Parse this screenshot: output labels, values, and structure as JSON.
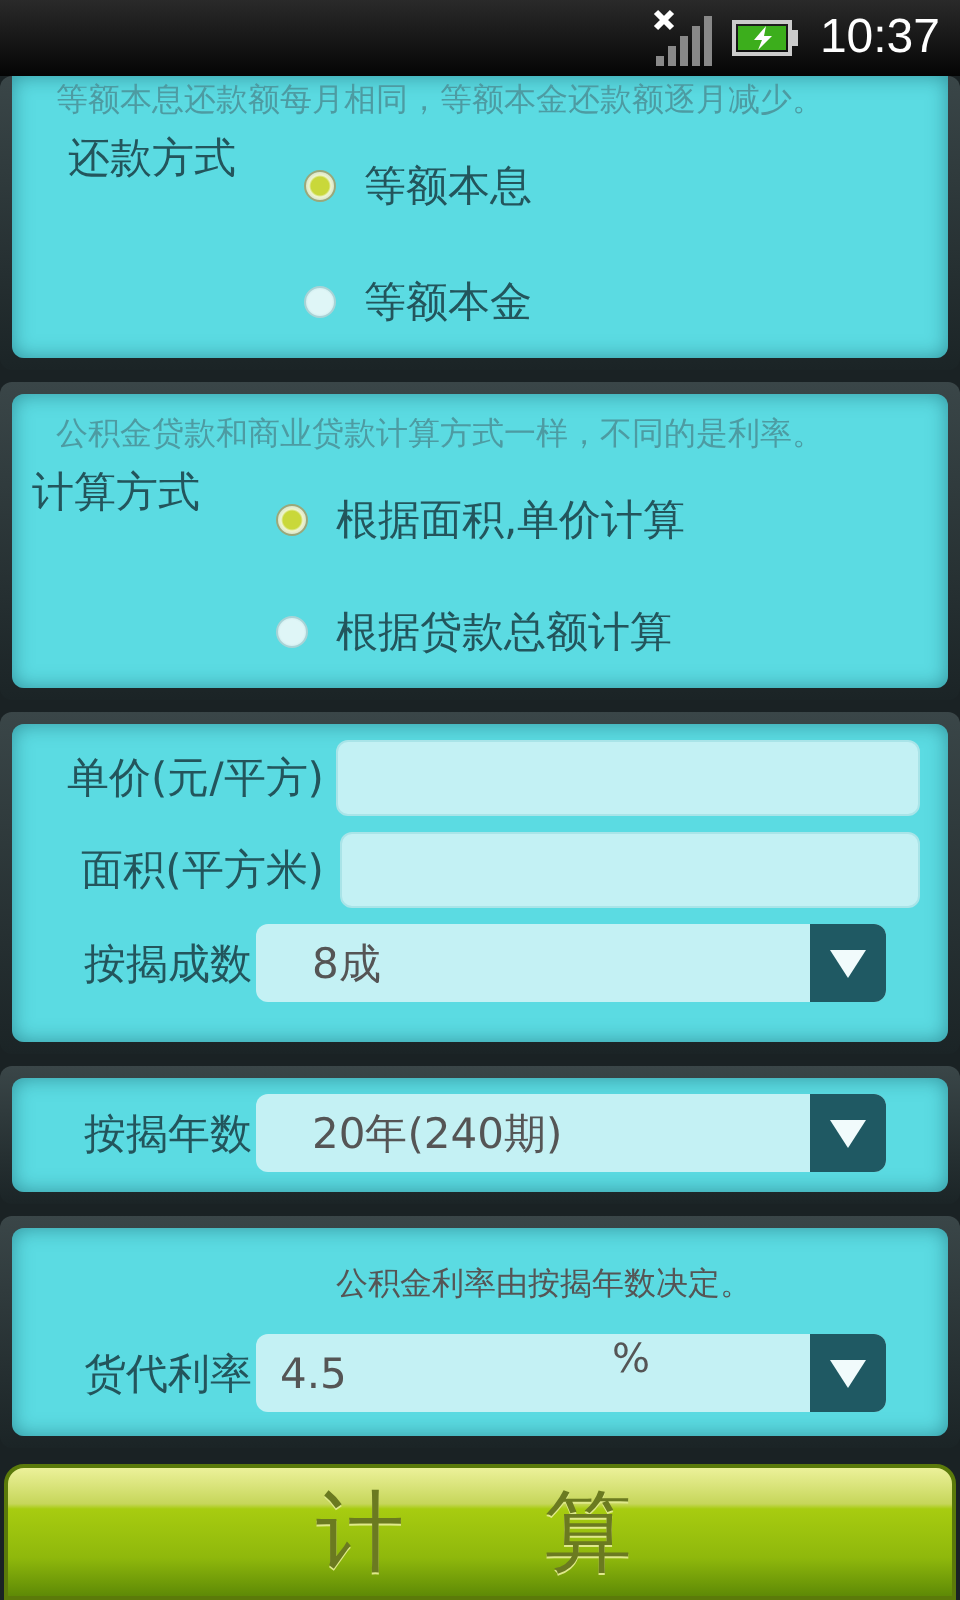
{
  "status_bar": {
    "time": "10:37"
  },
  "sections": [
    {
      "kind": "radio_group",
      "note": "等额本息还款额每月相同，等额本金还款额逐月减少。",
      "label": "还款方式",
      "options": [
        {
          "label": "等额本息",
          "selected": true
        },
        {
          "label": "等额本金",
          "selected": false
        }
      ]
    },
    {
      "kind": "radio_group",
      "note": "公积金贷款和商业贷款计算方式一样，不同的是利率。",
      "label": "计算方式",
      "options": [
        {
          "label": "根据面积,单价计算",
          "selected": true
        },
        {
          "label": "根据贷款总额计算",
          "selected": false
        }
      ]
    },
    {
      "kind": "form",
      "rows": [
        {
          "kind": "input",
          "label": "单价(元/平方)"
        },
        {
          "kind": "input",
          "label": "面积(平方米)"
        },
        {
          "kind": "select",
          "label": "按揭成数",
          "value": "8成"
        }
      ]
    },
    {
      "kind": "form",
      "rows": [
        {
          "kind": "select",
          "label": "按揭年数",
          "value": "20年(240期)"
        }
      ]
    },
    {
      "kind": "rate",
      "note": "公积金利率由按揭年数决定。",
      "label": "货代利率",
      "value": "4.5",
      "unit": "%"
    }
  ],
  "calculate_button": "计算"
}
